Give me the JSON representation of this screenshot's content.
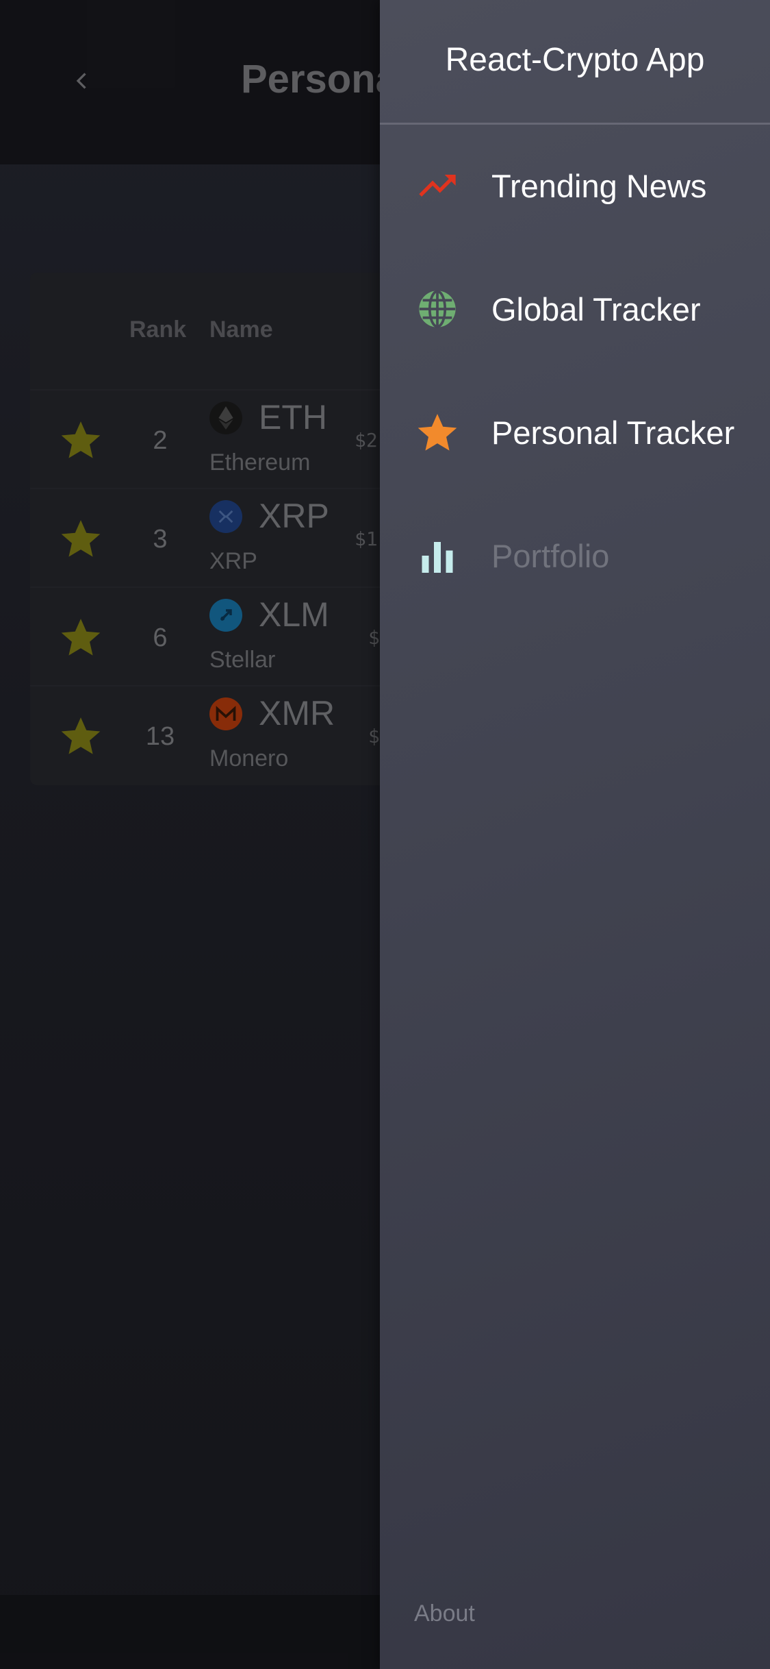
{
  "page": {
    "title": "Personal Tracker"
  },
  "table": {
    "headers": {
      "rank": "Rank",
      "name": "Name"
    },
    "rows": [
      {
        "rank": "2",
        "symbol": "ETH",
        "name": "Ethereum",
        "price_visible": "$2",
        "icon": "ethereum-icon",
        "icon_color": "#1e1e1e"
      },
      {
        "rank": "3",
        "symbol": "XRP",
        "name": "XRP",
        "price_visible": "$1",
        "icon": "xrp-icon",
        "icon_color": "#23488f"
      },
      {
        "rank": "6",
        "symbol": "XLM",
        "name": "Stellar",
        "price_visible": "$",
        "icon": "stellar-icon",
        "icon_color": "#1a7fb8"
      },
      {
        "rank": "13",
        "symbol": "XMR",
        "name": "Monero",
        "price_visible": "$",
        "icon": "monero-icon",
        "icon_color": "#c9410e"
      }
    ]
  },
  "drawer": {
    "title": "React-Crypto App",
    "items": [
      {
        "label": "Trending News",
        "icon": "trending-up-icon",
        "color": "#e0331e",
        "disabled": false
      },
      {
        "label": "Global Tracker",
        "icon": "globe-icon",
        "color": "#6fae72",
        "disabled": false
      },
      {
        "label": "Personal Tracker",
        "icon": "star-icon",
        "color": "#f28a2c",
        "disabled": false
      },
      {
        "label": "Portfolio",
        "icon": "bar-chart-icon",
        "color": "#c6ecec",
        "disabled": true
      }
    ],
    "footer_link": "About"
  },
  "colors": {
    "favorite_star": "#8c8a18",
    "drawer_bg": "#464856",
    "appbar_bg": "#1a1a20"
  }
}
